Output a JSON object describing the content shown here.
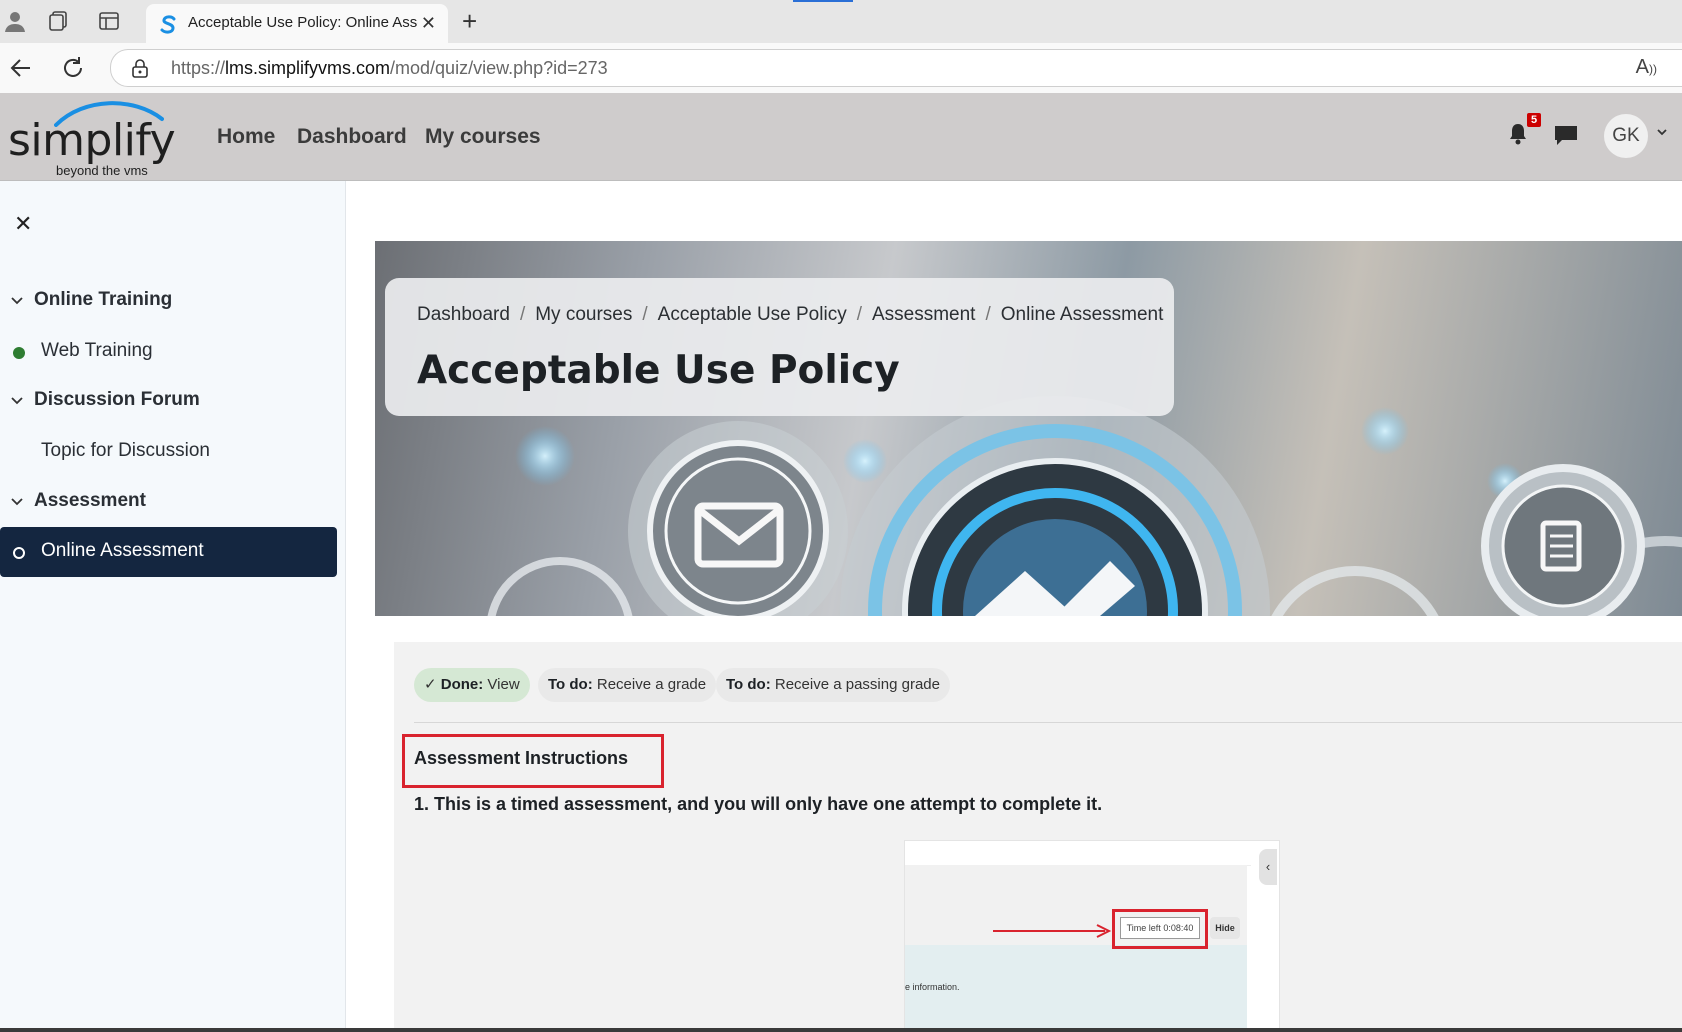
{
  "browser": {
    "tab_title": "Acceptable Use Policy: Online Assessment",
    "url_prefix": "https://",
    "url_host": "lms.simplifyvms.com",
    "url_path": "/mod/quiz/view.php?id=273"
  },
  "header": {
    "logo_text": "simplify",
    "logo_tagline": "beyond the vms",
    "nav": [
      "Home",
      "Dashboard",
      "My courses"
    ],
    "notification_count": "5",
    "user_initials": "GK"
  },
  "drawer": {
    "sections": [
      {
        "title": "Online Training",
        "items": [
          {
            "label": "Web Training",
            "status": "complete"
          }
        ]
      },
      {
        "title": "Discussion Forum",
        "items": [
          {
            "label": "Topic for Discussion",
            "status": "none"
          }
        ]
      },
      {
        "title": "Assessment",
        "items": [
          {
            "label": "Online Assessment",
            "status": "incomplete",
            "active": true
          }
        ]
      }
    ]
  },
  "breadcrumbs": [
    "Dashboard",
    "My courses",
    "Acceptable Use Policy",
    "Assessment",
    "Online Assessment"
  ],
  "page_title": "Acceptable Use Policy",
  "completion": [
    {
      "key": "Done:",
      "value": "View",
      "done": true
    },
    {
      "key": "To do:",
      "value": "Receive a grade",
      "done": false
    },
    {
      "key": "To do:",
      "value": "Receive a passing grade",
      "done": false
    }
  ],
  "content": {
    "instructions_title": "Assessment Instructions",
    "point_1": "1. This is a timed assessment, and you will only have one attempt to complete it.",
    "screenshot": {
      "time_left": "Time left 0:08:40",
      "hide_label": "Hide",
      "info_fragment": "e information."
    }
  },
  "colors": {
    "drawer_active_bg": "#142640",
    "complete_dot": "#2e7d32",
    "highlight_red": "#d9232e",
    "done_pill_bg": "#d5e8d4"
  }
}
